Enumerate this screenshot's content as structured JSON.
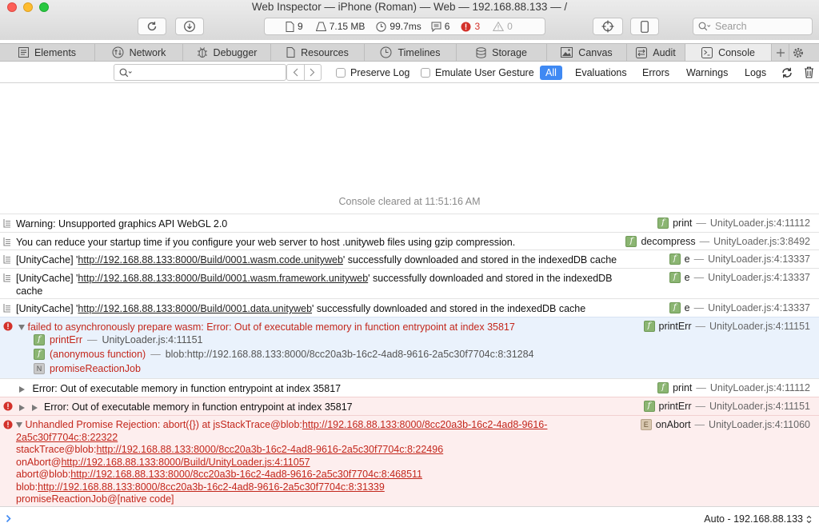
{
  "window": {
    "title": "Web Inspector — iPhone (Roman) — Web — 192.168.88.133 — /"
  },
  "toolbar": {
    "resource_count": "9",
    "resource_size": "7.15 MB",
    "load_time": "99.7ms",
    "log_count": "6",
    "error_count": "3",
    "warning_count": "0",
    "search_placeholder": "Search"
  },
  "tabs": [
    {
      "label": "Elements",
      "icon": "elements-icon"
    },
    {
      "label": "Network",
      "icon": "network-icon"
    },
    {
      "label": "Debugger",
      "icon": "debugger-icon"
    },
    {
      "label": "Resources",
      "icon": "resources-icon"
    },
    {
      "label": "Timelines",
      "icon": "timelines-icon"
    },
    {
      "label": "Storage",
      "icon": "storage-icon"
    },
    {
      "label": "Canvas",
      "icon": "canvas-icon"
    },
    {
      "label": "Audit",
      "icon": "audit-icon"
    },
    {
      "label": "Console",
      "icon": "console-icon",
      "active": true
    }
  ],
  "console_toolbar": {
    "preserve_log": "Preserve Log",
    "emulate_gesture": "Emulate User Gesture",
    "scopes": [
      "All",
      "Evaluations",
      "Errors",
      "Warnings",
      "Logs"
    ],
    "active_scope": "All"
  },
  "console": {
    "cleared": "Console cleared at 11:51:16 AM",
    "messages": [
      {
        "level": "log",
        "text": "Warning: Unsupported graphics API WebGL 2.0",
        "func": "print",
        "file": "UnityLoader.js:4:11112"
      },
      {
        "level": "log",
        "text": "You can reduce your startup time if you configure your web server to host .unityweb files using gzip compression.",
        "func": "decompress",
        "file": "UnityLoader.js:3:8492"
      },
      {
        "level": "log",
        "prefix": "[UnityCache] '",
        "url": "http://192.168.88.133:8000/Build/0001.wasm.code.unityweb",
        "suffix": "' successfully downloaded and stored in the indexedDB cache",
        "func": "e",
        "file": "UnityLoader.js:4:13337"
      },
      {
        "level": "log",
        "prefix": "[UnityCache] '",
        "url": "http://192.168.88.133:8000/Build/0001.wasm.framework.unityweb",
        "suffix": "' successfully downloaded and stored in the indexedDB",
        "suffix2": "cache",
        "func": "e",
        "file": "UnityLoader.js:4:13337"
      },
      {
        "level": "log",
        "prefix": "[UnityCache] '",
        "url": "http://192.168.88.133:8000/Build/0001.data.unityweb",
        "suffix": "' successfully downloaded and stored in the indexedDB cache",
        "func": "e",
        "file": "UnityLoader.js:4:13337"
      },
      {
        "level": "error",
        "text": "failed to asynchronously prepare wasm: Error: Out of executable memory in function entrypoint at index 35817",
        "func": "printErr",
        "file": "UnityLoader.js:4:11151",
        "stack": [
          {
            "badge": "f",
            "name": "printErr",
            "loc": "UnityLoader.js:4:11151"
          },
          {
            "badge": "f",
            "name": "(anonymous function)",
            "loc": "blob:http://192.168.88.133:8000/8cc20a3b-16c2-4ad8-9616-2a5c30f7704c:8:31284"
          },
          {
            "badge": "N",
            "name": "promiseReactionJob",
            "loc": ""
          }
        ]
      },
      {
        "level": "log",
        "text": "Error: Out of executable memory in function entrypoint at index 35817",
        "func": "print",
        "file": "UnityLoader.js:4:11112"
      },
      {
        "level": "error",
        "text": "Error: Out of executable memory in function entrypoint at index 35817",
        "func": "printErr",
        "file": "UnityLoader.js:4:11151"
      },
      {
        "level": "error",
        "line1_prefix": "Unhandled Promise Rejection: abort({}) at jsStackTrace@blob:",
        "line1_url": "http://192.168.88.133:8000/8cc20a3b-16c2-4ad8-9616-",
        "line2_url": "2a5c30f7704c:8:22322",
        "line3_prefix": "stackTrace@blob:",
        "line3_url": "http://192.168.88.133:8000/8cc20a3b-16c2-4ad8-9616-2a5c30f7704c:8:22496",
        "line4_prefix": "onAbort@",
        "line4_url": "http://192.168.88.133:8000/Build/UnityLoader.js:4:11057",
        "line5_prefix": "abort@blob:",
        "line5_url": "http://192.168.88.133:8000/8cc20a3b-16c2-4ad8-9616-2a5c30f7704c:8:468511",
        "line6_prefix": "blob:",
        "line6_url": "http://192.168.88.133:8000/8cc20a3b-16c2-4ad8-9616-2a5c30f7704c:8:31339",
        "line7": "promiseReactionJob@[native code]",
        "func": "onAbort",
        "file": "UnityLoader.js:4:11060"
      }
    ]
  },
  "prompt": {
    "target": "Auto - 192.168.88.133"
  },
  "colors": {
    "accent": "#3f89f3",
    "error": "#c3271c",
    "error_bg": "#fdeeee",
    "function_badge": "#8bb572"
  }
}
